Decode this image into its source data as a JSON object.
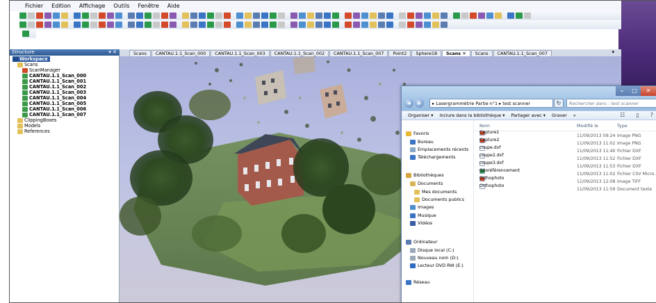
{
  "menu": [
    "Fichier",
    "Edition",
    "Affichage",
    "Outils",
    "Fenêtre",
    "Aide"
  ],
  "panel": {
    "title": "Structure",
    "controls": "▾ ✕"
  },
  "tree": [
    {
      "label": "Workspace",
      "level": 0,
      "selected": true,
      "bold": true
    },
    {
      "label": "Scans",
      "level": 1,
      "bold": false
    },
    {
      "label": "ScanManager",
      "level": 2,
      "bold": false
    },
    {
      "label": "CANTAU.1.1_Scan_000",
      "level": 2,
      "bold": true
    },
    {
      "label": "CANTAU.1.1_Scan_001",
      "level": 2,
      "bold": true
    },
    {
      "label": "CANTAU.1.1_Scan_002",
      "level": 2,
      "bold": true
    },
    {
      "label": "CANTAU.1.1_Scan_003",
      "level": 2,
      "bold": true
    },
    {
      "label": "CANTAU.1.1_Scan_004",
      "level": 2,
      "bold": true
    },
    {
      "label": "CANTAU.1.1_Scan_005",
      "level": 2,
      "bold": true
    },
    {
      "label": "CANTAU.1.1_Scan_006",
      "level": 2,
      "bold": true
    },
    {
      "label": "CANTAU.1.1_Scan_007",
      "level": 2,
      "bold": true
    },
    {
      "label": "ClippingBoxes",
      "level": 1,
      "bold": false
    },
    {
      "label": "Models",
      "level": 1,
      "bold": false
    },
    {
      "label": "References",
      "level": 1,
      "bold": false
    }
  ],
  "tabs": [
    {
      "label": "Scans",
      "active": false
    },
    {
      "label": "CANTAU.1.1_Scan_000",
      "active": false
    },
    {
      "label": "CANTAU.1.1_Scan_003",
      "active": false
    },
    {
      "label": "CANTAU.1.1_Scan_002",
      "active": false
    },
    {
      "label": "CANTAU.1.1_Scan_007",
      "active": false
    },
    {
      "label": "Point2",
      "active": false
    },
    {
      "label": "Sphere18",
      "active": false
    },
    {
      "label": "Scans ✕",
      "active": true
    },
    {
      "label": "Scans",
      "active": false
    },
    {
      "label": "CANTAU.1.1_Scan_007",
      "active": false
    }
  ],
  "explorer": {
    "window_controls": {
      "min": "–",
      "max": "□",
      "close": "✕"
    },
    "back": "◂",
    "forward": "▸",
    "address": "▸ Lasergrammétrie Partie n°1 ▸ test scanner",
    "refresh": "↻",
    "search_placeholder": "Rechercher dans : test scanner",
    "commands": [
      "Organiser ▾",
      "Inclure dans la bibliothèque ▾",
      "Partager avec ▾",
      "Graver",
      "»"
    ],
    "nav": [
      {
        "label": "Favoris",
        "icon": "star-icon",
        "color": "#e8b838"
      },
      {
        "label": "Bureau",
        "icon": "desktop-icon",
        "color": "#3a74c4"
      },
      {
        "label": "Emplacements récents",
        "icon": "recent-places-icon",
        "color": "#8aa8c8"
      },
      {
        "label": "Téléchargements",
        "icon": "download-icon",
        "color": "#3a74c4"
      },
      {
        "label": "Bibliothèques",
        "icon": "library-icon",
        "color": "#d7a640"
      },
      {
        "label": "Documents",
        "icon": "documents-icon",
        "color": "#d7b65a"
      },
      {
        "label": "Mes documents",
        "icon": "folder-icon",
        "color": "#e3c15a"
      },
      {
        "label": "Documents publics",
        "icon": "folder-icon",
        "color": "#e3c15a"
      },
      {
        "label": "Images",
        "icon": "images-icon",
        "color": "#4e8fd0"
      },
      {
        "label": "Musique",
        "icon": "music-icon",
        "color": "#3a74c4"
      },
      {
        "label": "Vidéos",
        "icon": "video-icon",
        "color": "#3a5ca4"
      },
      {
        "label": "Ordinateur",
        "icon": "computer-icon",
        "color": "#5a7cb0"
      },
      {
        "label": "Disque local (C:)",
        "icon": "drive-icon",
        "color": "#9aa8b8"
      },
      {
        "label": "Nouveau nom (D:)",
        "icon": "drive-icon",
        "color": "#9aa8b8"
      },
      {
        "label": "Lecteur DVD RW (E:)",
        "icon": "dvd-drive-icon",
        "color": "#2d6ac0"
      },
      {
        "label": "Réseau",
        "icon": "network-icon",
        "color": "#3a74c4"
      }
    ],
    "columns": [
      "Nom",
      "Modifié le",
      "Type"
    ],
    "files": [
      {
        "name": "Capture1",
        "date": "11/09/2013 09:24",
        "type": "Image PNG",
        "icon": "paint-icon",
        "color": "#d24a2a"
      },
      {
        "name": "Capture2",
        "date": "11/09/2013 11:02",
        "type": "Image PNG",
        "icon": "paint-icon",
        "color": "#d24a2a"
      },
      {
        "name": "coupe.dxf",
        "date": "11/09/2013 11:40",
        "type": "Fichier DXF",
        "icon": "file-icon",
        "color": "#ffffff"
      },
      {
        "name": "coupe2.dxf",
        "date": "11/09/2013 11:52",
        "type": "Fichier DXF",
        "icon": "file-icon",
        "color": "#ffffff"
      },
      {
        "name": "coupe3.dxf",
        "date": "11/09/2013 11:53",
        "type": "Fichier DXF",
        "icon": "file-icon",
        "color": "#ffffff"
      },
      {
        "name": "Géoréférencement",
        "date": "11/09/2013 11:02",
        "type": "Fichier CSV Micro...",
        "icon": "csv-icon",
        "color": "#2a9a4a"
      },
      {
        "name": "Orthophoto",
        "date": "11/09/2013 12:08",
        "type": "Image TIFF",
        "icon": "image-icon",
        "color": "#d24a2a"
      },
      {
        "name": "Orthophoto",
        "date": "11/09/2013 11:59",
        "type": "Document texte",
        "icon": "text-file-icon",
        "color": "#ffffff"
      }
    ]
  }
}
